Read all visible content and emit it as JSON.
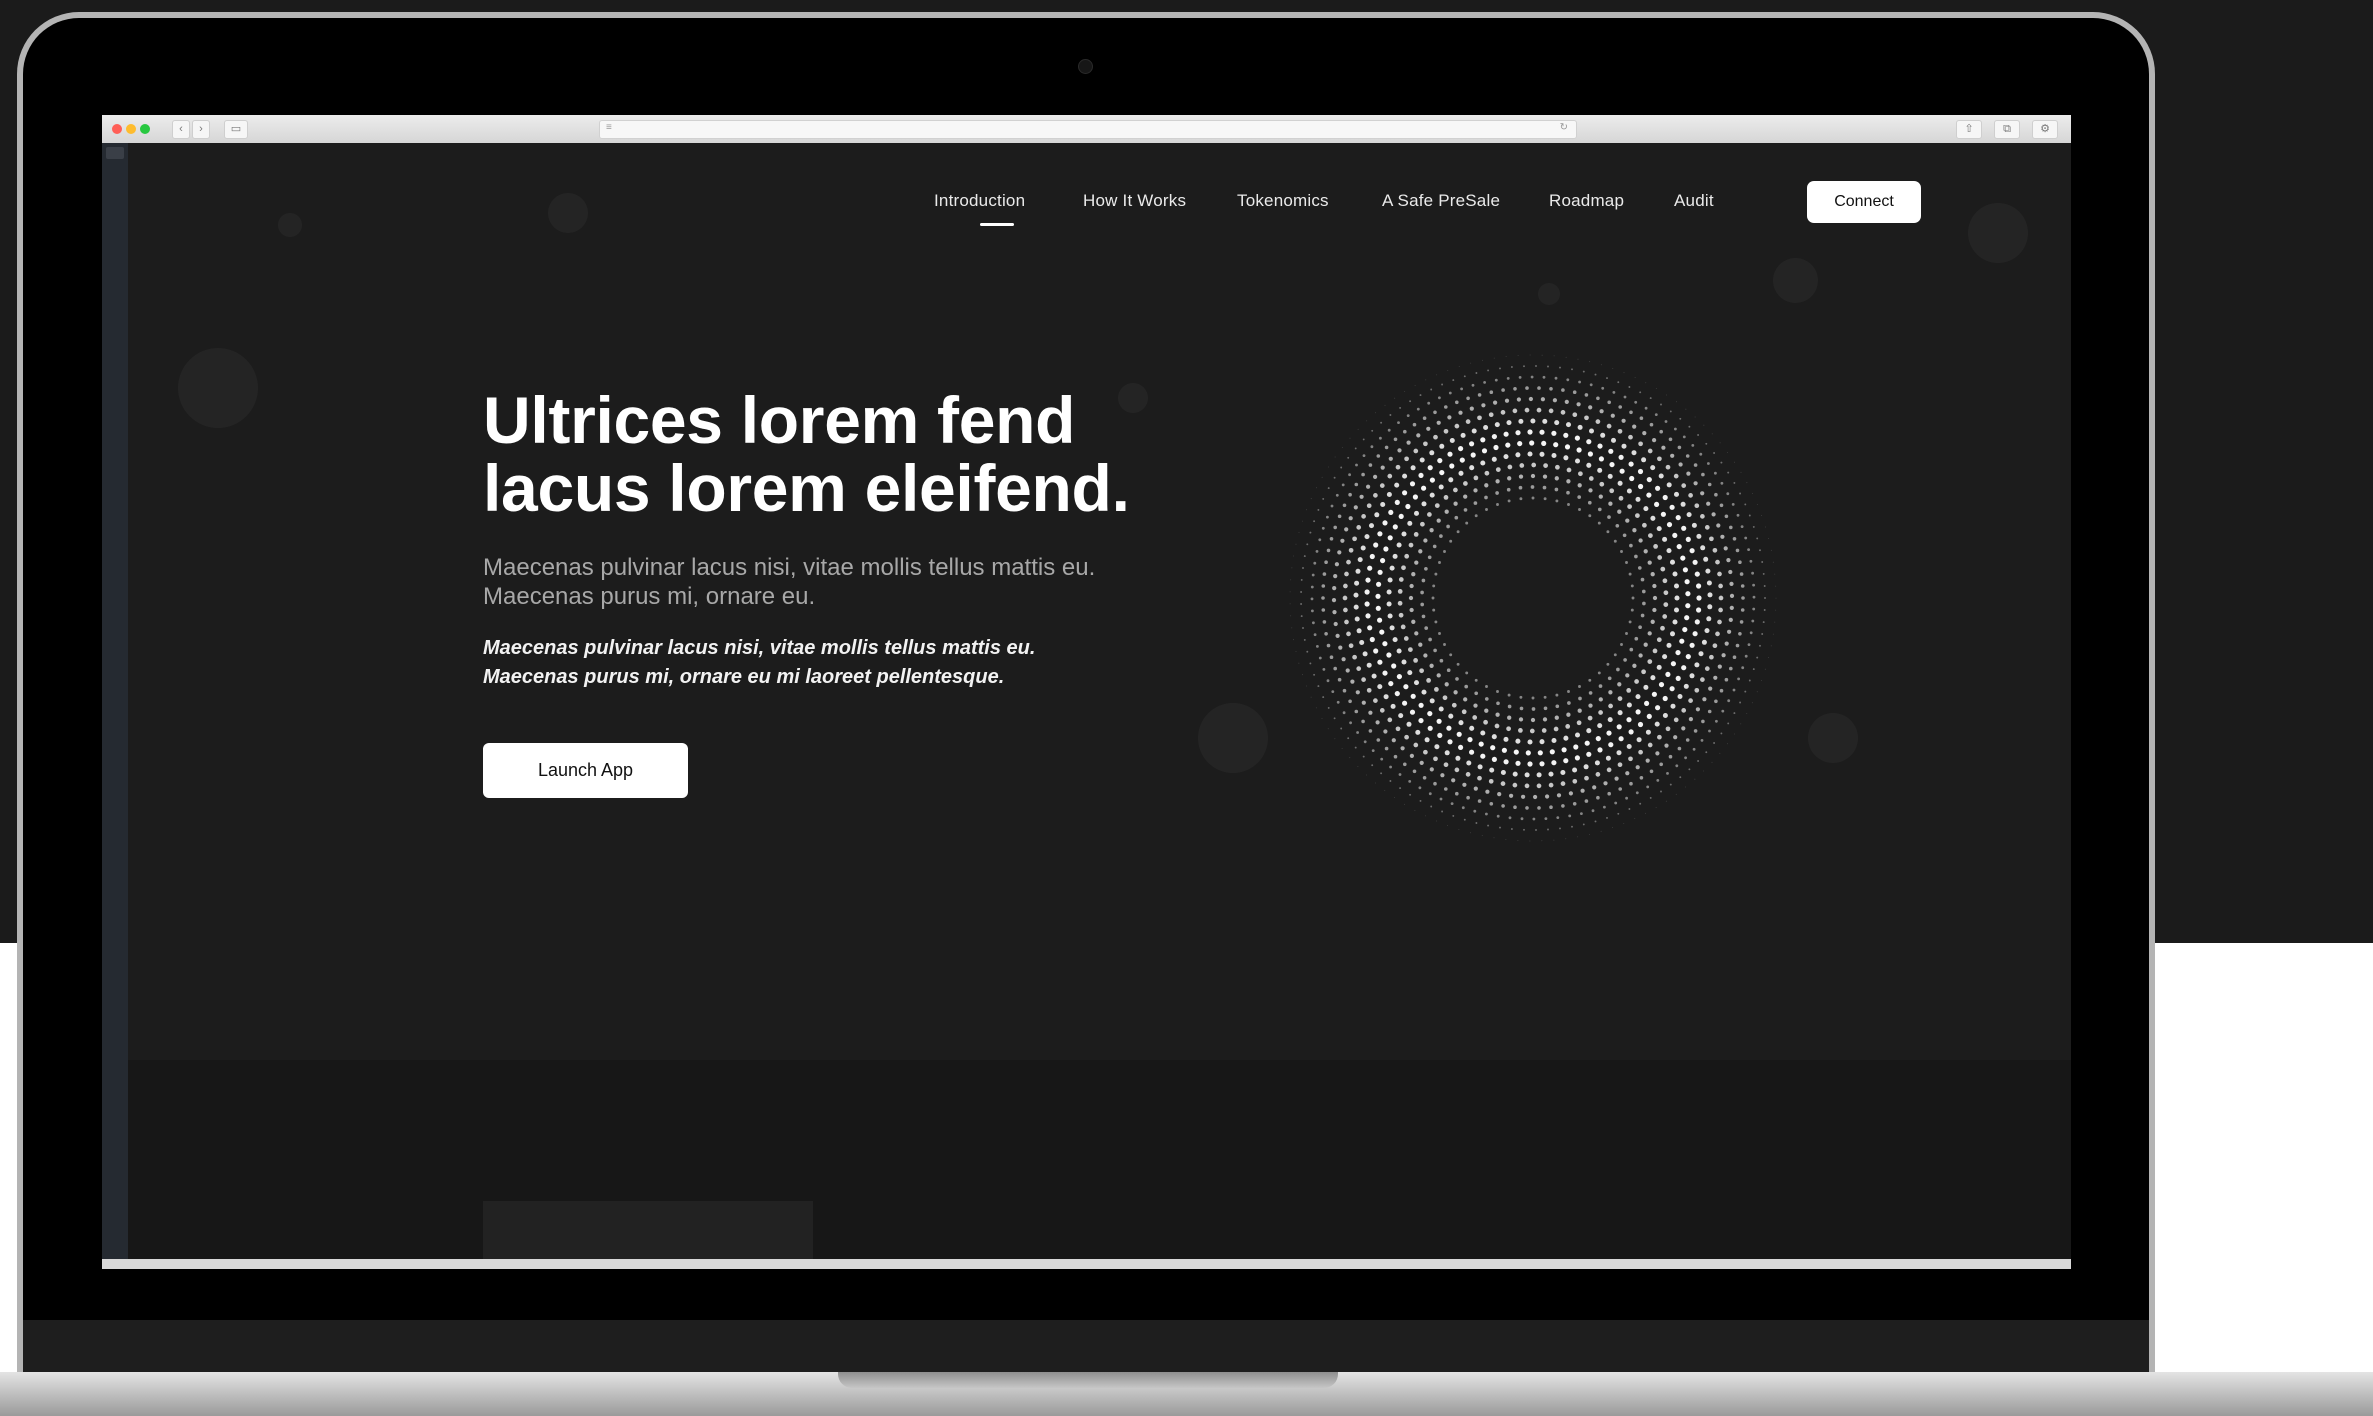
{
  "browser": {
    "back_glyph": "‹",
    "forward_glyph": "›",
    "sidebar_glyph": "▭",
    "url_left_glyph": "≡",
    "url_right_glyph": "↻",
    "share_glyph": "⇧",
    "tabs_glyph": "⧉",
    "settings_glyph": "⚙"
  },
  "nav": {
    "items": [
      {
        "label": "Introduction"
      },
      {
        "label": "How It Works"
      },
      {
        "label": "Tokenomics"
      },
      {
        "label": "A Safe PreSale"
      },
      {
        "label": "Roadmap"
      },
      {
        "label": "Audit"
      }
    ],
    "active": "Introduction",
    "connect_label": "Connect"
  },
  "hero": {
    "headline_line1": "Ultrices lorem fend",
    "headline_line2": "lacus lorem eleifend.",
    "subtext": "Maecenas pulvinar lacus nisi, vitae mollis tellus mattis eu. Maecenas purus mi, ornare eu.",
    "subtext_italic": "Maecenas pulvinar lacus nisi, vitae mollis tellus mattis eu. Maecenas purus mi, ornare eu mi laoreet pellentesque.",
    "launch_label": "Launch App"
  },
  "icons": {
    "graphic": "halftone-dot-ring"
  },
  "colors": {
    "page_bg": "#1c1c1c",
    "text_primary": "#ffffff",
    "text_secondary": "#a8a8a8",
    "button_bg": "#ffffff",
    "button_text": "#111111"
  }
}
